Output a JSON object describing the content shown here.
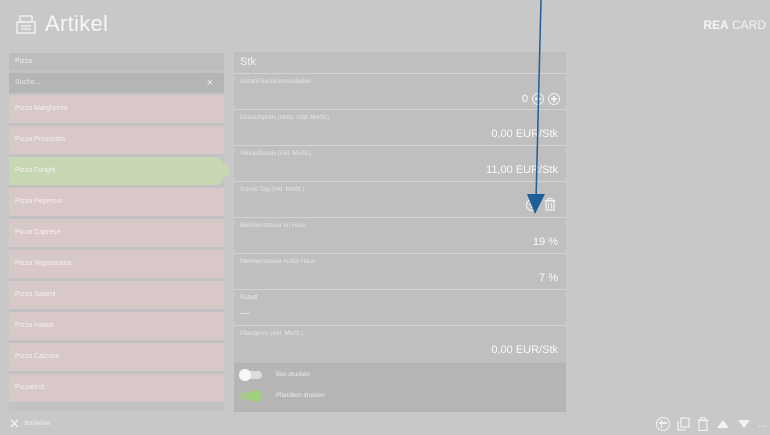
{
  "header": {
    "title": "Artikel",
    "brand_bold": "REA",
    "brand_rest": " CARD",
    "app_icon": "register-icon"
  },
  "sidebar": {
    "category": "Pizza",
    "search_placeholder": "Suche...",
    "clear_icon": "close-icon",
    "items": [
      {
        "label": "Pizza Margherita",
        "active": false
      },
      {
        "label": "Pizza Prosciutto",
        "active": false
      },
      {
        "label": "Pizza Funghi",
        "active": true
      },
      {
        "label": "Pizza Peperoni",
        "active": false
      },
      {
        "label": "Pizza Caprese",
        "active": false
      },
      {
        "label": "Pizza Vegetariana",
        "active": false
      },
      {
        "label": "Pizza Salami",
        "active": false
      },
      {
        "label": "Pizza Hawai",
        "active": false
      },
      {
        "label": "Pizza Calzone",
        "active": false
      },
      {
        "label": "Pizzabrot",
        "active": false
      }
    ]
  },
  "detail": {
    "unit": "Stk",
    "decimals": {
      "label": "Anzahl Nachkommastellen",
      "value": "0"
    },
    "purchase": {
      "label": "Einkaufspreis (netto, zzgl. MwSt.)",
      "value": "0,00 EUR/Stk"
    },
    "sale": {
      "label": "Verkaufspreis (inkl. MwSt.)",
      "value": "11,00 EUR/Stk"
    },
    "happy_day": {
      "label": "Scholo Tag (inkl. MwSt.)"
    },
    "vat_in": {
      "label": "Mehrwertsteuer Im Haus",
      "value": "19 %"
    },
    "vat_out": {
      "label": "Mehrwertsteuer Außer Haus",
      "value": "7 %"
    },
    "discount": {
      "label": "Rabatt",
      "value": "—"
    },
    "deposit": {
      "label": "Pfandpreis (inkl. MwSt.)",
      "value": "0,00 EUR/Stk"
    },
    "toggles": [
      {
        "label": "Bon drucken",
        "on": false
      },
      {
        "label": "Pfandbon drucken",
        "on": true
      }
    ]
  },
  "footer": {
    "close_label": "Schließen",
    "more": "..."
  },
  "colors": {
    "background": "#c8c8c8",
    "item_default": "#d9c8c8",
    "item_active": "#c7d6b3",
    "toggle_on": "#9fd17a",
    "annotation_arrow": "#1f5f99"
  }
}
